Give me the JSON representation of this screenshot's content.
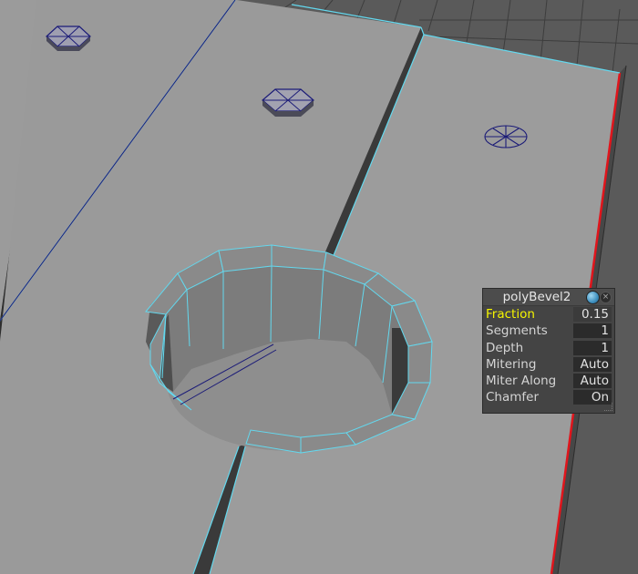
{
  "viewport": {
    "colors": {
      "background": "#5d5d5d",
      "plank_top": "#9a9a9a",
      "edge_highlight": "#63d8ee",
      "hole_inner": "#7d7d7d",
      "selection_edge": "#e0151c",
      "bolt_wire": "#1c1c78"
    }
  },
  "hud": {
    "title": "polyBevel2",
    "rows": [
      {
        "label": "Fraction",
        "value": "0.15",
        "active": true
      },
      {
        "label": "Segments",
        "value": "1",
        "active": false
      },
      {
        "label": "Depth",
        "value": "1",
        "active": false
      },
      {
        "label": "Mitering",
        "value": "Auto",
        "active": false
      },
      {
        "label": "Miter Along",
        "value": "Auto",
        "active": false
      },
      {
        "label": "Chamfer",
        "value": "On",
        "active": false
      }
    ]
  }
}
